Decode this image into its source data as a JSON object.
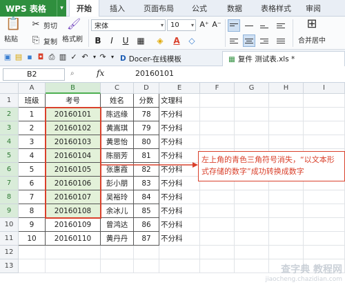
{
  "app": {
    "name": "WPS 表格"
  },
  "menu_tabs": [
    "开始",
    "插入",
    "页面布局",
    "公式",
    "数据",
    "表格样式",
    "审阅"
  ],
  "ribbon": {
    "paste": "粘贴",
    "cut": "剪切",
    "copy": "复制",
    "format_painter": "格式刷",
    "font_name": "宋体",
    "font_size": "10",
    "merge_center": "合并居中"
  },
  "doc_tabs": [
    "Docer-在线模板",
    "复件 测试表.xls *"
  ],
  "formula_bar": {
    "name_box": "B2",
    "fx": "fx",
    "value": "20160101"
  },
  "columns": [
    "A",
    "B",
    "C",
    "D",
    "E",
    "F",
    "G",
    "H",
    "I"
  ],
  "rows": [
    "1",
    "2",
    "3",
    "4",
    "5",
    "6",
    "7",
    "8",
    "9",
    "10",
    "11",
    "12",
    "13"
  ],
  "table": {
    "headers": [
      "班级",
      "考号",
      "姓名",
      "分数",
      "文理科"
    ],
    "data": [
      [
        "1",
        "20160101",
        "陈远缘",
        "78",
        "不分科"
      ],
      [
        "2",
        "20160102",
        "黄嵩琪",
        "79",
        "不分科"
      ],
      [
        "3",
        "20160103",
        "黄思怡",
        "80",
        "不分科"
      ],
      [
        "4",
        "20160104",
        "陈丽芳",
        "81",
        "不分科"
      ],
      [
        "5",
        "20160105",
        "张惠霞",
        "82",
        "不分科"
      ],
      [
        "6",
        "20160106",
        "彭小朋",
        "83",
        "不分科"
      ],
      [
        "7",
        "20160107",
        "吴裕玲",
        "84",
        "不分科"
      ],
      [
        "8",
        "20160108",
        "余冰儿",
        "85",
        "不分科"
      ],
      [
        "9",
        "20160109",
        "曾鸿达",
        "86",
        "不分科"
      ],
      [
        "10",
        "20160110",
        "黄丹丹",
        "87",
        "不分科"
      ]
    ]
  },
  "callout": {
    "text": "左上角的青色三角符号消失，“以文本形式存储的数字”成功转换成数字"
  },
  "watermark": {
    "line1": "查字典 教程网",
    "line2": "jiaocheng.chazidian.com"
  },
  "colors": {
    "accent": "#2f8f3e",
    "highlight": "#d9402b",
    "selection": "#e3f1d9"
  }
}
